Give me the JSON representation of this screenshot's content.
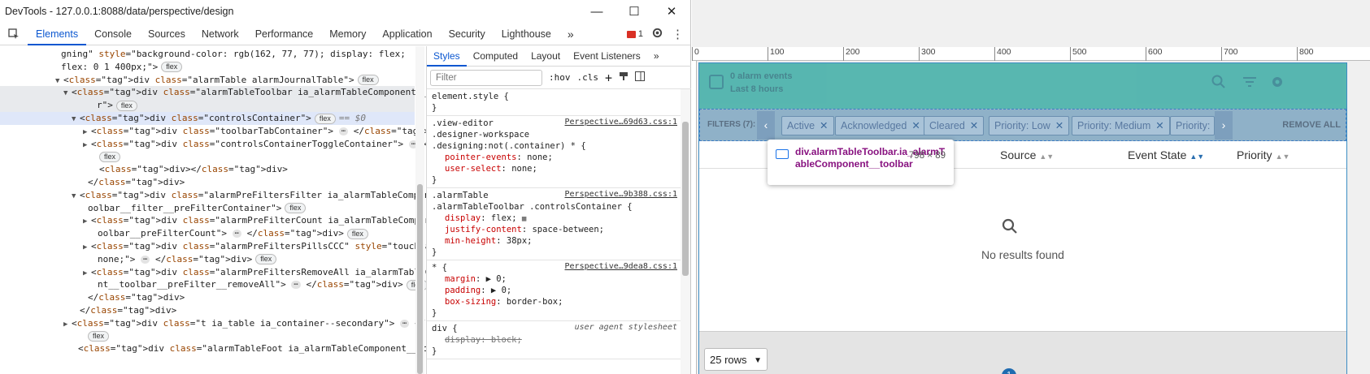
{
  "window": {
    "title": "DevTools - 127.0.0.1:8088/data/perspective/design",
    "minimize": "—",
    "maximize": "☐",
    "close": "✕"
  },
  "tabs": [
    "Elements",
    "Console",
    "Sources",
    "Network",
    "Performance",
    "Memory",
    "Application",
    "Security",
    "Lighthouse"
  ],
  "tabs_more": "»",
  "error_count": "1",
  "elements_lines": [
    {
      "indent": 75,
      "html": "gning\" style=\"background-color: rgb(162, 77, 77); display: flex;"
    },
    {
      "indent": 75,
      "html": "flex: 0 1 400px;\">",
      "pill": "flex"
    },
    {
      "indent": 78,
      "tri": "▼",
      "html": "<div class=\"alarmTable alarmJournalTable\">",
      "pill": "flex"
    },
    {
      "indent": 88,
      "tri": "▼",
      "html": "<div class=\"alarmTableToolbar ia_alarmTableComponent__toolba",
      "hl": true
    },
    {
      "indent": 119,
      "html": "r\">",
      "pill": "flex",
      "hl": true
    },
    {
      "indent": 98,
      "tri": "▼",
      "html": "<div class=\"controlsContainer\">",
      "pill": "flex",
      "eq": "== $0",
      "sel": true
    },
    {
      "indent": 112,
      "tri": "▶",
      "html": "<div class=\"toolbarTabContainer\">",
      "ell": "⋯",
      "html2": "</div>",
      "pill": "flex"
    },
    {
      "indent": 112,
      "tri": "▶",
      "html": "<div class=\"controlsContainerToggleContainer\">",
      "ell": "⋯",
      "html2": "</div>"
    },
    {
      "indent": 122,
      "pill_only": "flex"
    },
    {
      "indent": 122,
      "html": "<div></div>"
    },
    {
      "indent": 108,
      "html": "</div>"
    },
    {
      "indent": 98,
      "tri": "▼",
      "html": "<div class=\"alarmPreFiltersFilter ia_alarmTableComponent__t"
    },
    {
      "indent": 108,
      "html": "oolbar__filter__preFilterContainer\">",
      "pill": "flex"
    },
    {
      "indent": 112,
      "tri": "▶",
      "html": "<div class=\"alarmPreFilterCount ia_alarmTableComponent__t"
    },
    {
      "indent": 120,
      "html": "oolbar__preFilterCount\">",
      "ell": "⋯",
      "html2": "</div>",
      "pill": "flex"
    },
    {
      "indent": 112,
      "tri": "▶",
      "html": "<div class=\"alarmPreFiltersPillsCCC\" style=\"touch-action:"
    },
    {
      "indent": 120,
      "html": "none;\">",
      "ell": "⋯",
      "html2": "</div>",
      "pill": "flex"
    },
    {
      "indent": 112,
      "tri": "▶",
      "html": "<div class=\"alarmPreFiltersRemoveAll ia_alarmTableCompone"
    },
    {
      "indent": 120,
      "html": "nt__toolbar__preFilter__removeAll\">",
      "ell": "⋯",
      "html2": "</div>",
      "pill": "flex"
    },
    {
      "indent": 108,
      "html": "</div>"
    },
    {
      "indent": 98,
      "html": "</div>"
    },
    {
      "indent": 88,
      "tri": "▶",
      "html": "<div class=\"t ia_table ia_container--secondary\">",
      "ell": "⋯",
      "html2": "</div>"
    },
    {
      "indent": 108,
      "pill_only": "flex"
    },
    {
      "indent": 96,
      "html": "<div class=\"alarmTableFoot ia_alarmTableComponent__foot\">"
    }
  ],
  "styles": {
    "tabs": [
      "Styles",
      "Computed",
      "Layout",
      "Event Listeners"
    ],
    "tabs_more": "»",
    "filter_placeholder": "Filter",
    "hov": ":hov",
    "cls": ".cls",
    "rules": [
      {
        "lines": [
          "element.style {",
          "}"
        ],
        "src": ""
      },
      {
        "lines": [
          ".view-editor",
          ".designer-workspace",
          ".designing:not(.container) * {"
        ],
        "src": "Perspective…69d63.css:1",
        "props": [
          [
            "pointer-events",
            "none;"
          ],
          [
            "user-select",
            "none;"
          ]
        ]
      },
      {
        "lines": [
          ".alarmTable",
          ".alarmTableToolbar .controlsContainer {"
        ],
        "src": "Perspective…9b388.css:1",
        "props": [
          [
            "display",
            "flex;"
          ],
          [
            "justify-content",
            "space-between;"
          ],
          [
            "min-height",
            "38px;"
          ]
        ]
      },
      {
        "lines": [
          "* {"
        ],
        "src": "Perspective…9dea8.css:1",
        "props": [
          [
            "margin",
            "▶ 0;"
          ],
          [
            "padding",
            "▶ 0;"
          ],
          [
            "box-sizing",
            "border-box;"
          ]
        ]
      },
      {
        "lines": [
          "div {"
        ],
        "src": "user agent stylesheet",
        "ua": true,
        "props_strike": [
          [
            "display",
            "block;"
          ]
        ]
      }
    ]
  },
  "ruler": [
    "0",
    "100",
    "200",
    "300",
    "400",
    "500",
    "600",
    "700",
    "800"
  ],
  "app": {
    "event_count": "0 alarm events",
    "event_range": "Last 8 hours",
    "filters_label": "FILTERS (7):",
    "chips": [
      "Active",
      "Acknowledged",
      "Cleared",
      "Priority: Low",
      "Priority: Medium",
      "Priority:"
    ],
    "remove_all": "REMOVE ALL",
    "columns": [
      "Source",
      "Event State",
      "Priority"
    ],
    "no_results": "No results found",
    "rows_select": "25 rows",
    "page": "1",
    "colors": {
      "teal": "#4fb3ac",
      "filter_bg": "#8fb1c8",
      "accent": "#1f6bb0"
    }
  },
  "tooltip": {
    "name": "div.alarmTableToolbar.ia_alarmTableComponent__toolbar",
    "name_line1": "div.alarmTableToolbar.ia_alarmT",
    "name_line2": "ableComponent__toolbar",
    "dims": "798 × 89"
  }
}
